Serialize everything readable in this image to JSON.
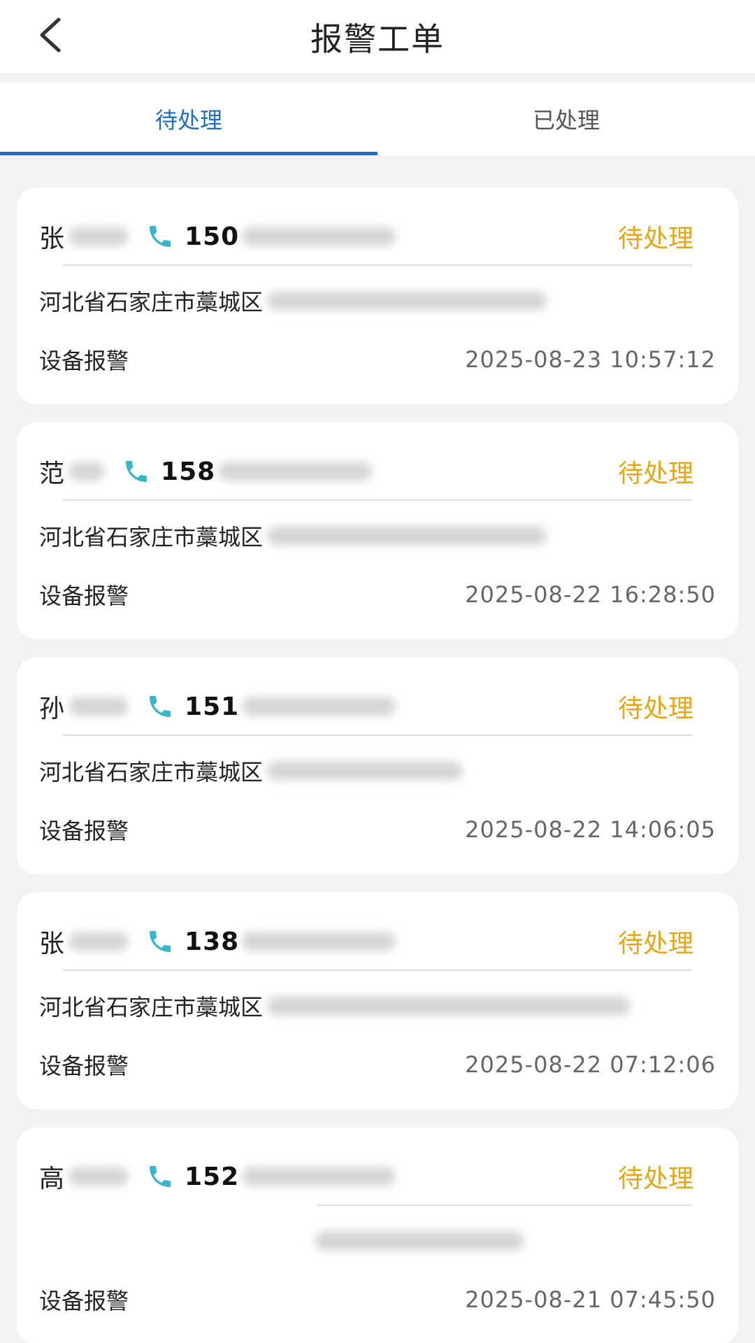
{
  "header": {
    "title": "报警工单",
    "back_icon": "chevron-left-icon"
  },
  "tabs": [
    {
      "label": "待处理",
      "active": true
    },
    {
      "label": "已处理",
      "active": false
    }
  ],
  "colors": {
    "accent": "#1d6ec1",
    "status": "#e0a61c",
    "phone_icon": "#35b7c4"
  },
  "orders": [
    {
      "surname": "张",
      "phone_prefix": "150",
      "status": "待处理",
      "address": "河北省石家庄市藁城区",
      "type": "设备报警",
      "time": "2025-08-23 10:57:12"
    },
    {
      "surname": "范",
      "phone_prefix": "158",
      "status": "待处理",
      "address": "河北省石家庄市藁城区",
      "type": "设备报警",
      "time": "2025-08-22 16:28:50"
    },
    {
      "surname": "孙",
      "phone_prefix": "151",
      "status": "待处理",
      "address": "河北省石家庄市藁城区",
      "type": "设备报警",
      "time": "2025-08-22 14:06:05"
    },
    {
      "surname": "张",
      "phone_prefix": "138",
      "status": "待处理",
      "address": "河北省石家庄市藁城区",
      "type": "设备报警",
      "time": "2025-08-22 07:12:06"
    },
    {
      "surname": "高",
      "phone_prefix": "152",
      "status": "待处理",
      "address": "",
      "type": "设备报警",
      "time": "2025-08-21 07:45:50"
    }
  ]
}
